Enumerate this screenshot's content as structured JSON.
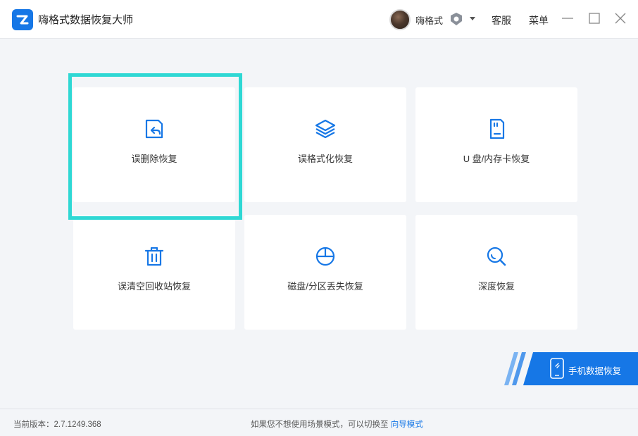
{
  "app": {
    "title": "嗨格式数据恢复大师"
  },
  "header": {
    "username": "嗨格式",
    "service_label": "客服",
    "menu_label": "菜单"
  },
  "cards": [
    {
      "label": "误删除恢复",
      "icon": "file-restore-icon"
    },
    {
      "label": "误格式化恢复",
      "icon": "layers-icon"
    },
    {
      "label": "U 盘/内存卡恢复",
      "icon": "sd-card-icon"
    },
    {
      "label": "误清空回收站恢复",
      "icon": "trash-icon"
    },
    {
      "label": "磁盘/分区丢失恢复",
      "icon": "pie-chart-icon"
    },
    {
      "label": "深度恢复",
      "icon": "magnifier-icon"
    }
  ],
  "mobile": {
    "label": "手机数据恢复"
  },
  "footer": {
    "version_text": "当前版本：2.7.1249.368",
    "hint_text": "如果您不想使用场景模式，可以切换至",
    "hint_link": "向导模式"
  },
  "colors": {
    "accent": "#1677e6",
    "highlight": "#2fd8d4",
    "background": "#f3f5f8"
  }
}
